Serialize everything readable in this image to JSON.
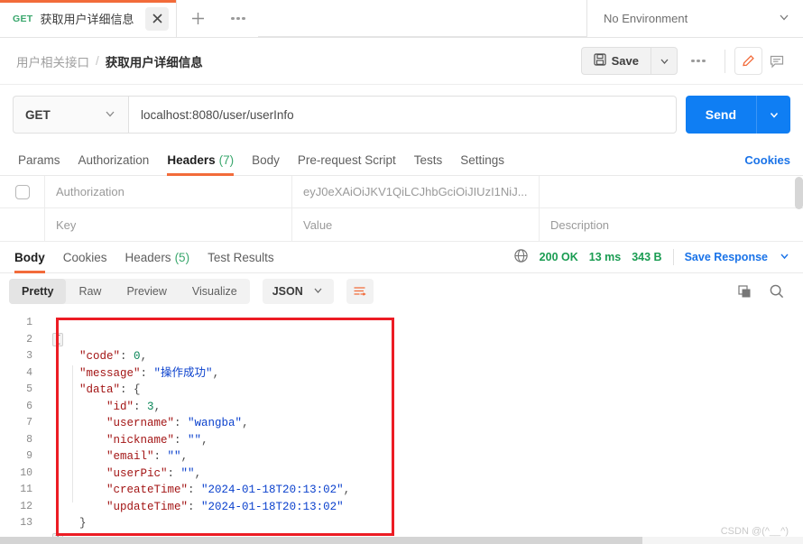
{
  "tab": {
    "method": "GET",
    "title": "获取用户详细信息",
    "close_icon": "close-icon",
    "new_tab_icon": "plus-icon",
    "more_icon": "ellipsis-icon"
  },
  "environment": {
    "selected": "No Environment",
    "caret_icon": "chevron-down-icon"
  },
  "breadcrumb": {
    "parent": "用户相关接口",
    "separator": "/",
    "current": "获取用户详细信息"
  },
  "toolbar": {
    "save_label": "Save",
    "save_icon": "floppy-disk-icon",
    "save_caret_icon": "chevron-down-icon",
    "more_icon": "ellipsis-icon",
    "edit_icon": "pencil-icon",
    "comment_icon": "comment-icon",
    "accent_color": "#f26b3a"
  },
  "request": {
    "method": "GET",
    "method_caret_icon": "chevron-down-icon",
    "url": "localhost:8080/user/userInfo",
    "send_label": "Send",
    "send_caret_icon": "chevron-down-icon",
    "send_color": "#0f7ef3"
  },
  "request_tabs": [
    {
      "label": "Params",
      "count": "",
      "active": false
    },
    {
      "label": "Authorization",
      "count": "",
      "active": false
    },
    {
      "label": "Headers",
      "count": "(7)",
      "active": true
    },
    {
      "label": "Body",
      "count": "",
      "active": false
    },
    {
      "label": "Pre-request Script",
      "count": "",
      "active": false
    },
    {
      "label": "Tests",
      "count": "",
      "active": false
    },
    {
      "label": "Settings",
      "count": "",
      "active": false
    }
  ],
  "cookies_link": "Cookies",
  "headers_table": {
    "rows": [
      {
        "checked": false,
        "key": "Authorization",
        "value": "eyJ0eXAiOiJKV1QiLCJhbGciOiJIUzI1NiJ...",
        "description": ""
      }
    ],
    "placeholder_row": {
      "key": "Key",
      "value": "Value",
      "description": "Description"
    }
  },
  "response_tabs": [
    {
      "label": "Body",
      "count": "",
      "active": true
    },
    {
      "label": "Cookies",
      "count": "",
      "active": false
    },
    {
      "label": "Headers",
      "count": "(5)",
      "active": false
    },
    {
      "label": "Test Results",
      "count": "",
      "active": false
    }
  ],
  "response_meta": {
    "globe_icon": "globe-icon",
    "status": "200 OK",
    "time": "13 ms",
    "size": "343 B",
    "save_response": "Save Response",
    "save_response_caret_icon": "chevron-down-icon"
  },
  "body_toolbar": {
    "views": [
      {
        "label": "Pretty",
        "selected": true
      },
      {
        "label": "Raw",
        "selected": false
      },
      {
        "label": "Preview",
        "selected": false
      },
      {
        "label": "Visualize",
        "selected": false
      }
    ],
    "format": "JSON",
    "format_caret_icon": "chevron-down-icon",
    "wrap_icon": "wrap-lines-icon",
    "copy_icon": "copy-icon",
    "search_icon": "search-icon"
  },
  "response_body": {
    "line_numbers": [
      "1",
      "2",
      "3",
      "4",
      "5",
      "6",
      "7",
      "8",
      "9",
      "10",
      "11",
      "12",
      "13"
    ],
    "lines": [
      {
        "n": 1,
        "text": "{"
      },
      {
        "n": 2,
        "text": "    \"code\": 0,"
      },
      {
        "n": 3,
        "text": "    \"message\": \"操作成功\","
      },
      {
        "n": 4,
        "text": "    \"data\": {"
      },
      {
        "n": 5,
        "text": "        \"id\": 3,"
      },
      {
        "n": 6,
        "text": "        \"username\": \"wangba\","
      },
      {
        "n": 7,
        "text": "        \"nickname\": \"\","
      },
      {
        "n": 8,
        "text": "        \"email\": \"\","
      },
      {
        "n": 9,
        "text": "        \"userPic\": \"\","
      },
      {
        "n": 10,
        "text": "        \"createTime\": \"2024-01-18T20:13:02\","
      },
      {
        "n": 11,
        "text": "        \"updateTime\": \"2024-01-18T20:13:02\""
      },
      {
        "n": 12,
        "text": "    }"
      },
      {
        "n": 13,
        "text": "}"
      }
    ],
    "json": {
      "code": 0,
      "message": "操作成功",
      "data": {
        "id": 3,
        "username": "wangba",
        "nickname": "",
        "email": "",
        "userPic": "",
        "createTime": "2024-01-18T20:13:02",
        "updateTime": "2024-01-18T20:13:02"
      }
    },
    "tokens": {
      "code_key": "\"code\"",
      "code_val": "0",
      "message_key": "\"message\"",
      "message_val": "\"操作成功\"",
      "data_key": "\"data\"",
      "id_key": "\"id\"",
      "id_val": "3",
      "username_key": "\"username\"",
      "username_val": "\"wangba\"",
      "nickname_key": "\"nickname\"",
      "nickname_val": "\"\"",
      "email_key": "\"email\"",
      "email_val": "\"\"",
      "userPic_key": "\"userPic\"",
      "userPic_val": "\"\"",
      "createTime_key": "\"createTime\"",
      "createTime_val": "\"2024-01-18T20:13:02\"",
      "updateTime_key": "\"updateTime\"",
      "updateTime_val": "\"2024-01-18T20:13:02\""
    }
  },
  "annotation": {
    "color": "#ec1c24"
  },
  "watermark": "CSDN @(^__^)"
}
